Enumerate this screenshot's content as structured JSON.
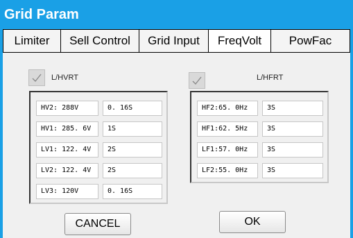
{
  "window": {
    "title": "Grid Param"
  },
  "tabs": [
    {
      "label": "Limiter"
    },
    {
      "label": "Sell Control"
    },
    {
      "label": "Grid Input"
    },
    {
      "label": "FreqVolt"
    },
    {
      "label": "PowFac"
    }
  ],
  "active_tab": "FreqVolt",
  "voltage": {
    "checkbox_label": "L/HVRT",
    "checked": true,
    "rows": [
      {
        "param": "HV2: 288V",
        "time": "0. 16S"
      },
      {
        "param": "HV1: 285. 6V",
        "time": "1S"
      },
      {
        "param": "LV1: 122. 4V",
        "time": "2S"
      },
      {
        "param": "LV2: 122. 4V",
        "time": "2S"
      },
      {
        "param": "LV3: 120V",
        "time": "0. 16S"
      }
    ]
  },
  "frequency": {
    "checkbox_label": "L/HFRT",
    "checked": true,
    "rows": [
      {
        "param": "HF2:65. 0Hz",
        "time": "3S"
      },
      {
        "param": "HF1:62. 5Hz",
        "time": "3S"
      },
      {
        "param": "LF1:57. 0Hz",
        "time": "3S"
      },
      {
        "param": "LF2:55. 0Hz",
        "time": "3S"
      }
    ]
  },
  "buttons": {
    "cancel": "CANCEL",
    "ok": "OK"
  },
  "colors": {
    "title_bar": "#1aa0e6",
    "panel_bg": "#f0f0f0",
    "checkbox_bg": "#d9d9d9"
  }
}
